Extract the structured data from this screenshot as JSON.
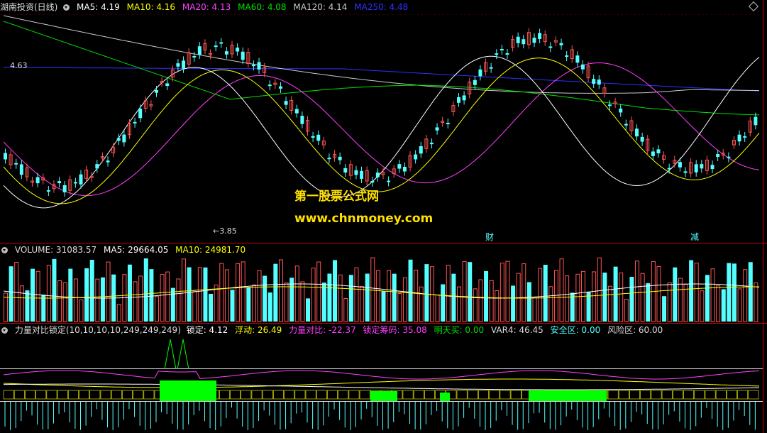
{
  "colors": {
    "up": "#ff5454",
    "down": "#54ffff",
    "ma5": "#ffffff",
    "ma10": "#ffff00",
    "ma20": "#ff40ff",
    "ma60": "#00e000",
    "ma120": "#c8c8c8",
    "ma250": "#3030ff",
    "separator": "#c00000",
    "watermark": "#ffe000",
    "lock_bar": "#00ff00",
    "text_header": "#dddddd",
    "label_fu": "#ffff00",
    "label_rong": "#ff40ff"
  },
  "main_panel": {
    "stock_title": "湖南投资(日线)",
    "ma5_label": "MA5: 4.19",
    "ma10_label": "MA10: 4.16",
    "ma20_label": "MA20: 4.13",
    "ma60_label": "MA60: 4.08",
    "ma120_label": "MA120: 4.14",
    "ma250_label": "MA250: 4.48",
    "high_marker": "4.63",
    "low_marker": "3.85",
    "event_fin": "财",
    "event_reduce": "减",
    "watermark_line1": "第一股票公式网",
    "watermark_line2": "www.chnmoney.com"
  },
  "volume_panel": {
    "volume_label": "VOLUME: 31083.57",
    "ma5_label": "MA5: 29664.05",
    "ma10_label": "MA10: 24981.70"
  },
  "indicator_panel": {
    "formula_title": "力量对比锁定(10,10,10,10,249,249,249)",
    "lock_label": "锁定: 4.12",
    "float_label": "浮动: 26.49",
    "power_label": "力量对比: -22.37",
    "lock_chips_label": "锁定筹码: 35.08",
    "tomorrow_buy_label": "明天买: 0.00",
    "var4_label": "VAR4: 46.45",
    "safe_zone_label": "安全区: 0.00",
    "risk_zone_label": "风险区: 60.00"
  },
  "chart_data": {
    "type": "candlestick",
    "price_high": 4.63,
    "price_low": 3.85,
    "ma_last": {
      "MA5": 4.19,
      "MA10": 4.16,
      "MA20": 4.13,
      "MA60": 4.08,
      "MA120": 4.14,
      "MA250": 4.48
    },
    "volume_last": 31083.57,
    "volume_ma5": 29664.05,
    "volume_ma10": 24981.7
  }
}
